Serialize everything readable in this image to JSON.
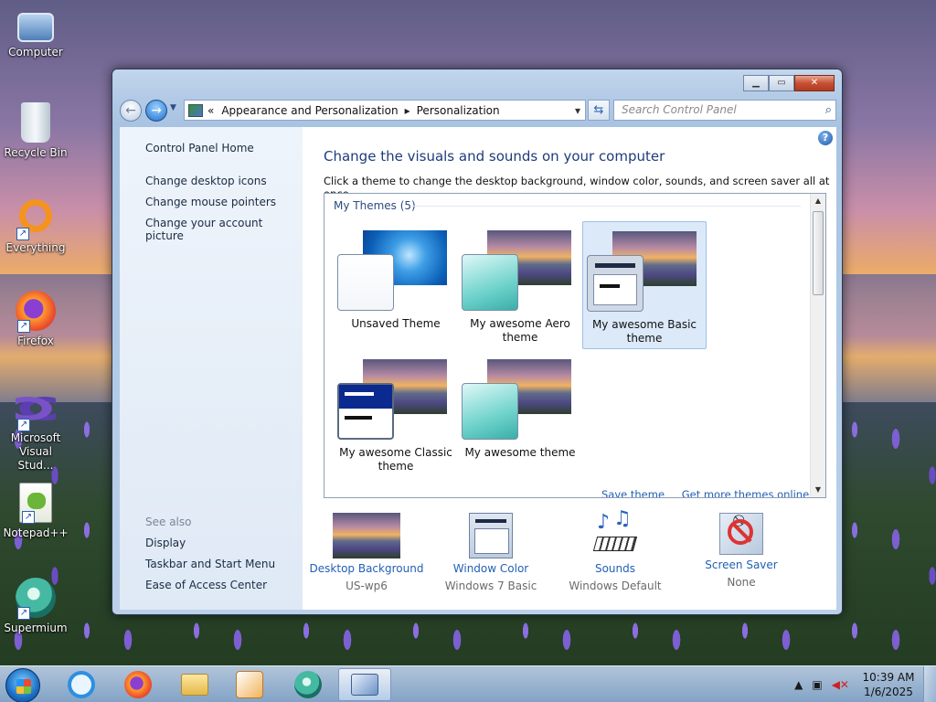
{
  "desktop": {
    "icons": [
      {
        "label": "Computer",
        "icon": "computer-icon"
      },
      {
        "label": "Recycle Bin",
        "icon": "recycle-bin-icon"
      },
      {
        "label": "Everything",
        "icon": "everything-icon"
      },
      {
        "label": "Firefox",
        "icon": "firefox-icon"
      },
      {
        "label": "Microsoft Visual Stud...",
        "icon": "visual-studio-icon"
      },
      {
        "label": "Notepad++",
        "icon": "notepadpp-icon"
      },
      {
        "label": "Supermium",
        "icon": "supermium-icon"
      }
    ]
  },
  "window": {
    "address": {
      "recent": "«",
      "crumbs": [
        "Appearance and Personalization",
        "Personalization"
      ]
    },
    "search": {
      "placeholder": "Search Control Panel"
    },
    "left_pane": {
      "home": "Control Panel Home",
      "links": [
        "Change desktop icons",
        "Change mouse pointers",
        "Change your account picture"
      ],
      "see_also_label": "See also",
      "see_also": [
        "Display",
        "Taskbar and Start Menu",
        "Ease of Access Center"
      ]
    },
    "main": {
      "title": "Change the visuals and sounds on your computer",
      "subtitle": "Click a theme to change the desktop background, window color, sounds, and screen saver all at once.",
      "group_label": "My Themes (5)",
      "themes": [
        {
          "label": "Unsaved Theme",
          "selected": false
        },
        {
          "label": "My awesome Aero theme",
          "selected": false
        },
        {
          "label": "My awesome Basic theme",
          "selected": true
        },
        {
          "label": "My awesome Classic theme",
          "selected": false
        },
        {
          "label": "My awesome theme",
          "selected": false
        }
      ],
      "save_link": "Save theme",
      "more_link": "Get more themes online",
      "bottom": [
        {
          "title": "Desktop Background",
          "value": "US-wp6"
        },
        {
          "title": "Window Color",
          "value": "Windows 7 Basic"
        },
        {
          "title": "Sounds",
          "value": "Windows Default"
        },
        {
          "title": "Screen Saver",
          "value": "None"
        }
      ]
    }
  },
  "taskbar": {
    "clock": {
      "time": "10:39 AM",
      "date": "1/6/2025"
    }
  }
}
